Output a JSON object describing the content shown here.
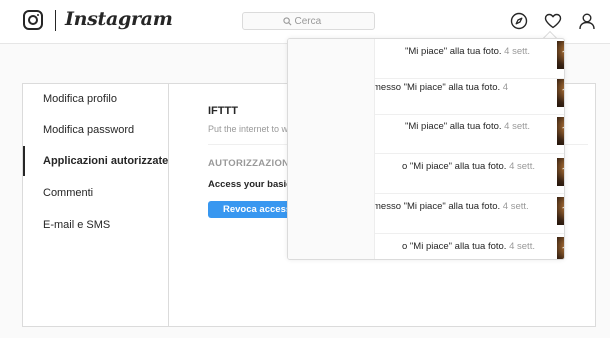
{
  "header": {
    "brand": "Instagram",
    "search_placeholder": "Cerca"
  },
  "sidebar": {
    "items": [
      {
        "label": "Modifica profilo",
        "active": false
      },
      {
        "label": "Modifica password",
        "active": false
      },
      {
        "label": "Applicazioni autorizzate",
        "active": true
      },
      {
        "label": "Commenti",
        "active": false
      },
      {
        "label": "E-mail e SMS",
        "active": false
      }
    ]
  },
  "app": {
    "name": "IFTTT",
    "description": "Put the internet to w",
    "auth_heading": "AUTORIZZAZIONI",
    "access_text": "Access your basic i",
    "revoke_label": "Revoca accesso"
  },
  "activity": {
    "items": [
      {
        "text": "\"Mi piace\" alla tua foto.",
        "time": "4 sett."
      },
      {
        "text": "messo \"Mi piace\" alla tua foto.",
        "time": "4"
      },
      {
        "text": "\"Mi piace\" alla tua foto.",
        "time": "4 sett."
      },
      {
        "text": "o \"Mi piace\" alla tua foto.",
        "time": "4 sett."
      },
      {
        "text": "messo \"Mi piace\" alla tua foto.",
        "time": "4 sett."
      },
      {
        "text": "o \"Mi piace\" alla tua foto.",
        "time": "4 sett."
      }
    ]
  },
  "colors": {
    "accent": "#3897f0",
    "border": "#dbdbdb",
    "text": "#262626",
    "muted": "#999999"
  }
}
